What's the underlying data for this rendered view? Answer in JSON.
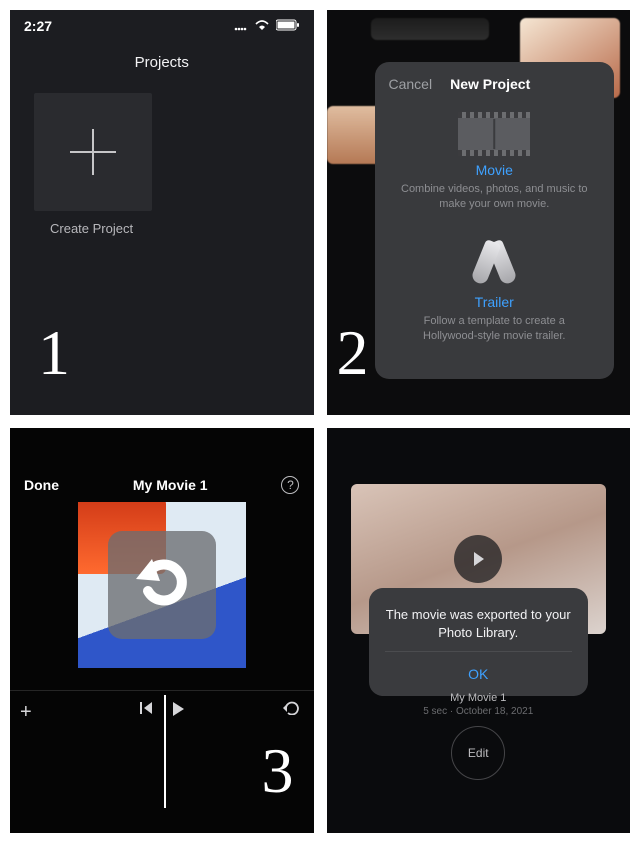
{
  "panel1": {
    "status_time": "2:27",
    "header": "Projects",
    "create_label": "Create Project",
    "number": "1"
  },
  "panel2": {
    "cancel": "Cancel",
    "sheet_title": "New Project",
    "movie": {
      "title": "Movie",
      "desc": "Combine videos, photos, and music to make your own movie."
    },
    "trailer": {
      "title": "Trailer",
      "desc": "Follow a template to create a Hollywood-style movie trailer."
    },
    "number": "2"
  },
  "panel3": {
    "done": "Done",
    "title": "My Movie 1",
    "help": "?",
    "tl_add": "+",
    "number": "3"
  },
  "panel4": {
    "dialog_msg": "The movie was exported to your Photo Library.",
    "ok": "OK",
    "movie_name": "My Movie 1",
    "movie_meta": "5 sec · October 18, 2021",
    "edit": "Edit"
  }
}
